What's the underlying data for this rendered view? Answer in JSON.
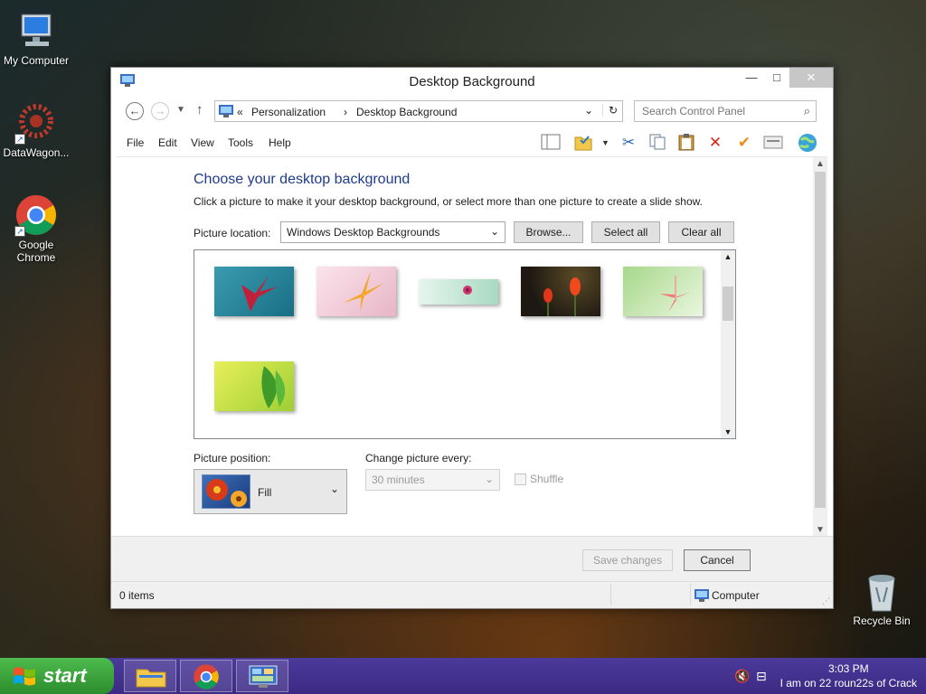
{
  "desktop": {
    "icons": [
      {
        "label": "My Computer",
        "icon": "computer-icon"
      },
      {
        "label": "DataWagon...",
        "icon": "datawagon-icon"
      },
      {
        "label": "Google Chrome",
        "icon": "chrome-icon"
      },
      {
        "label": "Recycle Bin",
        "icon": "recycle-bin-icon"
      }
    ]
  },
  "window": {
    "title": "Desktop Background",
    "controls": {
      "minimize": "—",
      "maximize": "□",
      "close": "✕"
    },
    "address": {
      "prefix": "«",
      "crumbs": [
        "Personalization",
        "Desktop Background"
      ],
      "separator": "›"
    },
    "search": {
      "placeholder": "Search Control Panel"
    },
    "menu": [
      "File",
      "Edit",
      "View",
      "Tools",
      "Help"
    ],
    "toolbar_icons": [
      "layout-icon",
      "folder-check-icon",
      "cut-icon",
      "copy-icon",
      "paste-icon",
      "delete-icon",
      "check-icon",
      "properties-icon",
      "globe-icon"
    ],
    "content": {
      "heading": "Choose your desktop background",
      "subtext": "Click a picture to make it your desktop background, or select more than one picture to create a slide show.",
      "picture_location_label": "Picture location:",
      "picture_location_value": "Windows Desktop Backgrounds",
      "browse_label": "Browse...",
      "select_all_label": "Select all",
      "clear_all_label": "Clear all",
      "picture_position_label": "Picture position:",
      "picture_position_value": "Fill",
      "change_every_label": "Change picture every:",
      "change_every_value": "30 minutes",
      "shuffle_label": "Shuffle",
      "wallpapers": [
        {
          "name": "red flower on teal",
          "colors": [
            "#2f8aa0",
            "#c2203a"
          ]
        },
        {
          "name": "yellow flower on pink",
          "colors": [
            "#f3d2dc",
            "#f2a62a"
          ]
        },
        {
          "name": "pink flower on mint",
          "colors": [
            "#bfe3d2",
            "#d0336e"
          ]
        },
        {
          "name": "red tulips dark",
          "colors": [
            "#2b2218",
            "#e2361a"
          ]
        },
        {
          "name": "pink lily on green",
          "colors": [
            "#cfe9b8",
            "#f07a7a"
          ]
        },
        {
          "name": "green leaves",
          "colors": [
            "#d5e85a",
            "#3f9a2a"
          ]
        }
      ]
    },
    "footer": {
      "save_label": "Save changes",
      "cancel_label": "Cancel"
    },
    "status": {
      "items": "0 items",
      "location": "Computer"
    }
  },
  "taskbar": {
    "start_label": "start",
    "time": "3:03 PM",
    "tray_text": "I am on 22 roun22s of Crack",
    "apps": [
      "file-explorer-icon",
      "chrome-icon",
      "control-panel-icon"
    ]
  }
}
